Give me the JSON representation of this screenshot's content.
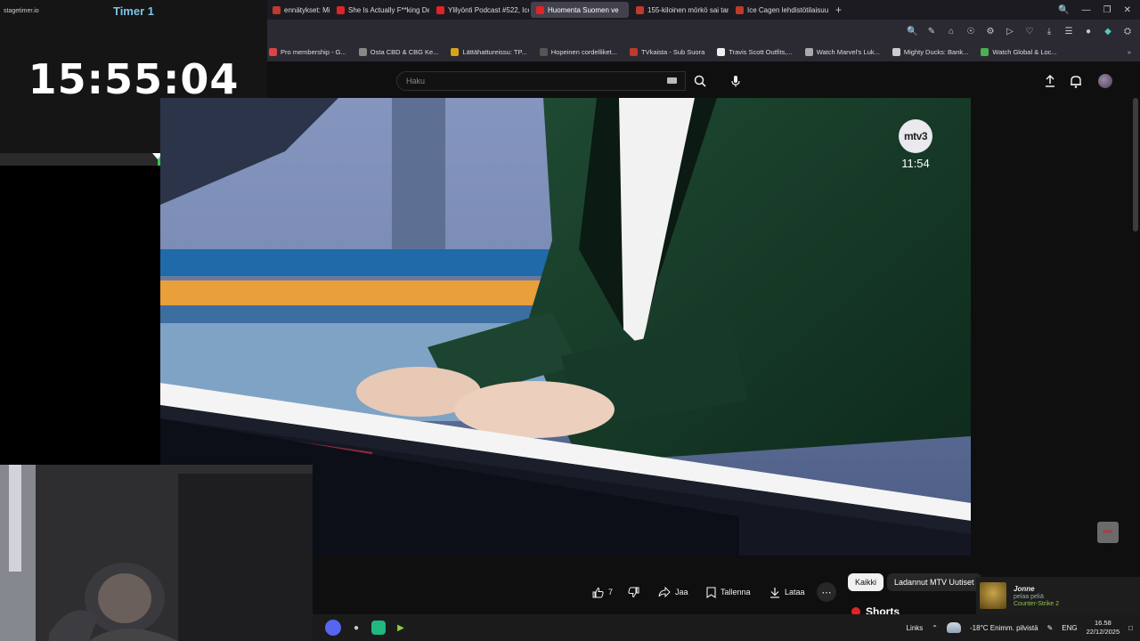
{
  "timer": {
    "logo": "stagetimer.io",
    "title": "Timer 1",
    "time": "15:55:04",
    "progress_fraction": 0.41
  },
  "browser": {
    "tabs": [
      {
        "label": "ennätykset: Mitkä E",
        "color": "#c0392b",
        "active": false
      },
      {
        "label": "She Is Actually F**king De",
        "color": "#e02424",
        "active": false
      },
      {
        "label": "Ylilyönti Podcast #522, Ice",
        "color": "#e02424",
        "active": false
      },
      {
        "label": "Huomenta Suomen ve",
        "color": "#e02424",
        "active": true
      },
      {
        "label": "155-kiloinen mörkö sai tar",
        "color": "#c0392b",
        "active": false
      },
      {
        "label": "Ice Cagen lehdistötilaisuu",
        "color": "#c0392b",
        "active": false
      }
    ],
    "new_tab": "+",
    "bookmarks": [
      {
        "label": "Pro membership - G...",
        "color": "#d44"
      },
      {
        "label": "Osta CBD & CBG Ke...",
        "color": "#888"
      },
      {
        "label": "Lättähattureissu: TP...",
        "color": "#d9a21b"
      },
      {
        "label": "Hopeinen cordelliket...",
        "color": "#555"
      },
      {
        "label": "TVkaista - Sub Suora",
        "color": "#c0392b"
      },
      {
        "label": "Travis Scott Outfits,...",
        "color": "#eee"
      },
      {
        "label": "Watch Marvel's Luk...",
        "color": "#aaa"
      },
      {
        "label": "Mighty Ducks: Bank...",
        "color": "#ccc"
      },
      {
        "label": "Watch Global & Loc...",
        "color": "#4caf50"
      }
    ]
  },
  "youtube": {
    "search_placeholder": "Haku",
    "video": {
      "channel_logo": "mtv3",
      "broadcast_time": "11:54"
    },
    "like_count": "7",
    "actions": {
      "share": "Jaa",
      "save": "Tallenna",
      "download": "Lataa"
    },
    "chips": [
      "Kaikki",
      "Ladannut MTV Uutiset"
    ],
    "shorts_label": "Shorts",
    "small_badge": "mtv"
  },
  "steam": {
    "name": "Jonne",
    "status": "pelaa peliä",
    "game": "Counter-Strike 2"
  },
  "taskbar": {
    "links": "Links",
    "weather": "-18°C  Enimm. pilvistä",
    "language": "ENG",
    "time": "16.58",
    "date": "22/12/2025"
  },
  "colors": {
    "accent_green": "#37c94e",
    "timer_title": "#7ec3e6",
    "youtube_red": "#e02424"
  }
}
